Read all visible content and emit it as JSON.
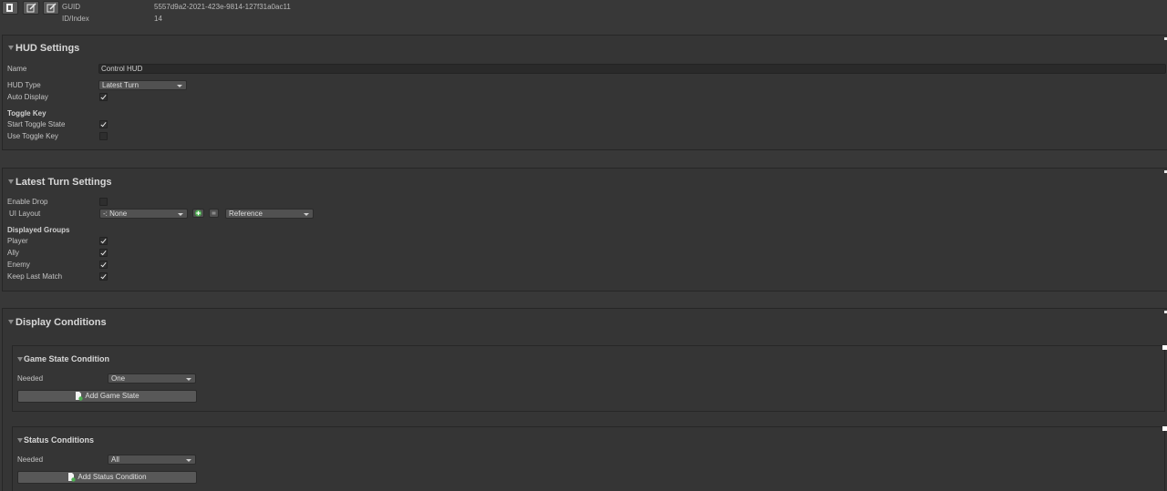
{
  "header": {
    "guid_label": "GUID",
    "guid_value": "5557d9a2-2021-423e-9814-127f31a0ac11",
    "index_label": "ID/Index",
    "index_value": "14"
  },
  "hud_settings": {
    "title": "HUD Settings",
    "name_label": "Name",
    "name_value": "Control HUD",
    "hud_type_label": "HUD Type",
    "hud_type_value": "Latest Turn",
    "auto_display_label": "Auto Display",
    "auto_display": true,
    "toggle_key_header": "Toggle Key",
    "start_toggle_label": "Start Toggle State",
    "start_toggle": true,
    "use_toggle_label": "Use Toggle Key",
    "use_toggle": false
  },
  "latest_turn": {
    "title": "Latest Turn Settings",
    "enable_drop_label": "Enable Drop",
    "enable_drop": false,
    "ui_layout_label": "UI Layout",
    "ui_layout_value": "-: None",
    "reference_value": "Reference",
    "displayed_groups_header": "Displayed Groups",
    "groups": [
      {
        "label": "Player",
        "checked": true
      },
      {
        "label": "Ally",
        "checked": true
      },
      {
        "label": "Enemy",
        "checked": true
      },
      {
        "label": "Keep Last Match",
        "checked": true
      }
    ]
  },
  "display_conditions": {
    "title": "Display Conditions",
    "game_state": {
      "title": "Game State Condition",
      "needed_label": "Needed",
      "needed_value": "One",
      "add_button": "Add Game State"
    },
    "status": {
      "title": "Status Conditions",
      "needed_label": "Needed",
      "needed_value": "All",
      "add_button": "Add Status Condition"
    }
  },
  "colors": {
    "background": "#383838",
    "panel": "#353535",
    "field": "#2a2a2a",
    "dropdown": "#515151",
    "accent_green": "#4caf50"
  },
  "icons": [
    "copy-icon",
    "edit-icon",
    "edit-icon",
    "add-icon",
    "add-icon"
  ]
}
